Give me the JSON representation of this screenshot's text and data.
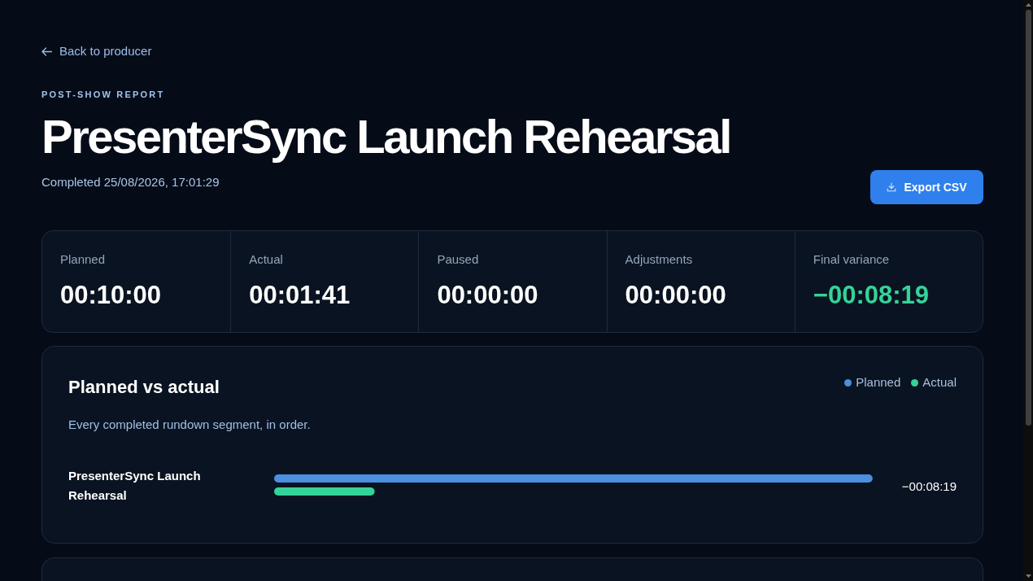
{
  "back_link": {
    "label": "Back to producer"
  },
  "header": {
    "eyebrow": "POST-SHOW REPORT",
    "title": "PresenterSync Launch Rehearsal",
    "completed": "Completed 25/08/2026, 17:01:29",
    "export_button": "Export CSV"
  },
  "stats": [
    {
      "label": "Planned",
      "value": "00:10:00",
      "kind": "duration"
    },
    {
      "label": "Actual",
      "value": "00:01:41",
      "kind": "duration"
    },
    {
      "label": "Paused",
      "value": "00:00:00",
      "kind": "duration"
    },
    {
      "label": "Adjustments",
      "value": "00:00:00",
      "kind": "duration"
    },
    {
      "label": "Final variance",
      "value": "−00:08:19",
      "kind": "variance"
    }
  ],
  "comparison": {
    "title": "Planned vs actual",
    "legend": [
      {
        "label": "Planned",
        "color": "#4a8fe0"
      },
      {
        "label": "Actual",
        "color": "#34d399"
      }
    ],
    "subtitle": "Every completed rundown segment, in order.",
    "segments": [
      {
        "name": "PresenterSync Launch Rehearsal",
        "variance": "−00:08:19"
      }
    ]
  }
}
